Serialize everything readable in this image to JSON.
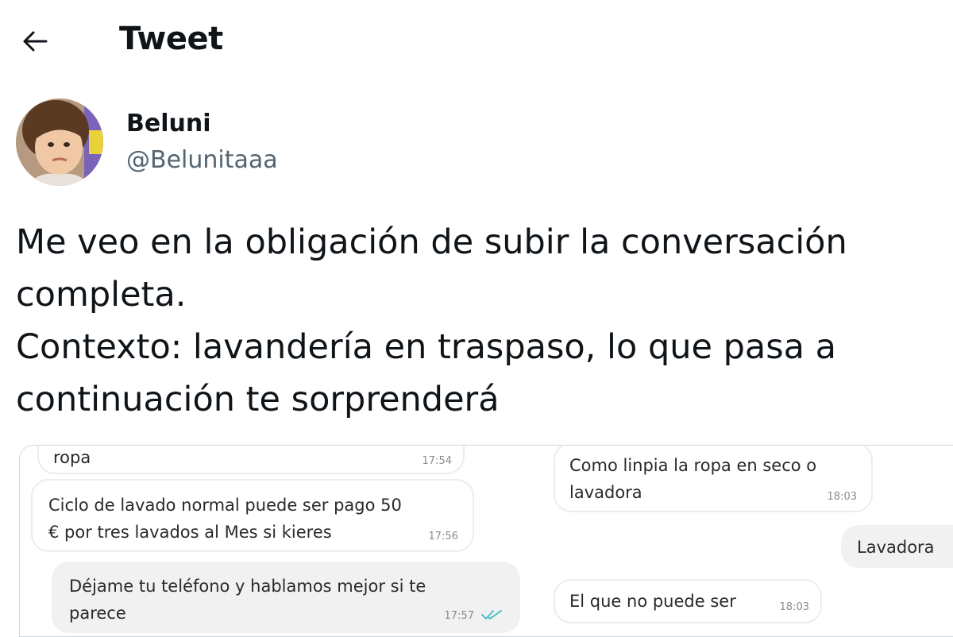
{
  "header": {
    "title": "Tweet",
    "back_icon": "arrow-left-icon"
  },
  "author": {
    "display_name": "Beluni",
    "handle": "@Belunitaaa"
  },
  "tweet": {
    "lines": [
      "Me veo en la obligación de subir la conversación",
      "completa.",
      "Contexto: lavandería en traspaso, lo que pasa a",
      "continuación te sorprenderá"
    ]
  },
  "chat": {
    "messages": [
      {
        "text": "ropa",
        "time": "17:54",
        "side": "left"
      },
      {
        "text": "Ciclo de lavado normal puede ser pago 50\n€ por tres lavados al Mes si kieres",
        "time": "17:56",
        "side": "left"
      },
      {
        "text": "Déjame tu teléfono y hablamos mejor si te\nparece",
        "time": "17:57",
        "side": "left-grey",
        "read_icon": "double-check-icon"
      },
      {
        "text": "Como linpia la ropa en seco o\nlavadora",
        "time": "18:03",
        "side": "right"
      },
      {
        "text": "Lavadora",
        "time": "",
        "side": "right-grey"
      },
      {
        "text": "El que no puede ser",
        "time": "18:03",
        "side": "right"
      }
    ],
    "read_color": "#4fc3c9"
  }
}
